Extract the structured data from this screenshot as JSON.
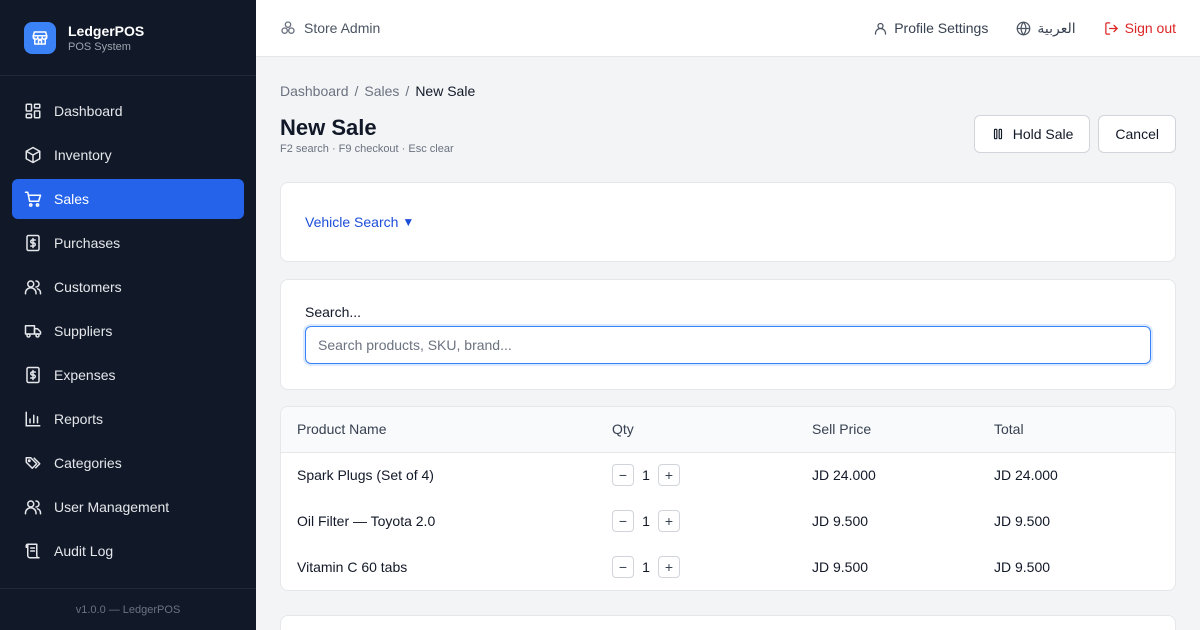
{
  "brand": {
    "name": "LedgerPOS",
    "subtitle": "POS System"
  },
  "sidebar": {
    "items": [
      {
        "label": "Dashboard",
        "icon": "dashboard-icon",
        "active": false
      },
      {
        "label": "Inventory",
        "icon": "box-icon",
        "active": false
      },
      {
        "label": "Sales",
        "icon": "cart-icon",
        "active": true
      },
      {
        "label": "Purchases",
        "icon": "dollar-receipt-icon",
        "active": false
      },
      {
        "label": "Customers",
        "icon": "users-icon",
        "active": false
      },
      {
        "label": "Suppliers",
        "icon": "truck-icon",
        "active": false
      },
      {
        "label": "Expenses",
        "icon": "dollar-receipt-icon",
        "active": false
      },
      {
        "label": "Reports",
        "icon": "bar-chart-icon",
        "active": false
      },
      {
        "label": "Categories",
        "icon": "tags-icon",
        "active": false
      },
      {
        "label": "User Management",
        "icon": "users-icon",
        "active": false
      },
      {
        "label": "Audit Log",
        "icon": "scroll-icon",
        "active": false
      }
    ],
    "footer": "v1.0.0 — LedgerPOS"
  },
  "topbar": {
    "store": "Store Admin",
    "profile": "Profile Settings",
    "language": "العربية",
    "signout": "Sign out"
  },
  "breadcrumb": {
    "items": [
      "Dashboard",
      "Sales"
    ],
    "current": "New Sale",
    "separator": "/"
  },
  "page": {
    "title": "New Sale",
    "shortcuts": "F2 search · F9 checkout · Esc clear",
    "hold_label": "Hold Sale",
    "cancel_label": "Cancel"
  },
  "vehicle": {
    "label": "Vehicle Search",
    "arrow": "▼"
  },
  "search": {
    "label": "Search...",
    "placeholder": "Search products, SKU, brand..."
  },
  "table": {
    "headers": [
      "Product Name",
      "Qty",
      "Sell Price",
      "Total"
    ],
    "rows": [
      {
        "name": "Spark Plugs (Set of 4)",
        "qty": "1",
        "price": "JD 24.000",
        "total": "JD 24.000"
      },
      {
        "name": "Oil Filter — Toyota 2.0",
        "qty": "1",
        "price": "JD 9.500",
        "total": "JD 9.500"
      },
      {
        "name": "Vitamin C 60 tabs",
        "qty": "1",
        "price": "JD 9.500",
        "total": "JD 9.500"
      }
    ],
    "minus": "−",
    "plus": "+"
  },
  "colors": {
    "sidebar_bg": "#111827",
    "accent": "#2563eb",
    "danger": "#dc2626",
    "link": "#1d4ed8"
  }
}
